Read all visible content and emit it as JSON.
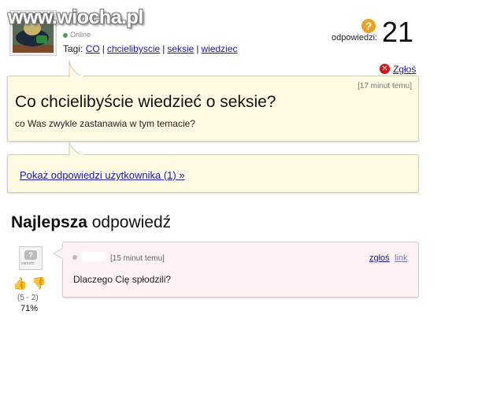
{
  "watermark": "www.wiocha.pl",
  "header": {
    "status_text": "Online",
    "tags_label": "Tagi:",
    "tags": [
      "CO",
      "chcielibyscie",
      "seksie",
      "wiedziec"
    ],
    "answers_label": "odpowiedzi:",
    "answers_count": "21",
    "report_label": "Zgłoś"
  },
  "question": {
    "time": "[17 minut temu]",
    "title": "Co chcielibyście wiedzieć o seksie?",
    "subtitle": "co Was zwykle zastanawia w tym temacie?"
  },
  "user_answers_link": "Pokaż odpowiedzi użytkownika (1) »",
  "best_answer": {
    "heading_bold": "Najlepsza",
    "heading_rest": " odpowiedź",
    "avatar_caption": "samotn",
    "votes": "(5 - 2)",
    "percent": "71%",
    "time": "[15 minut temu]",
    "report_label": "zgłoś",
    "link_label": "link",
    "text": "Dlaczego Cię spłodzili?"
  },
  "colors": {
    "bubble_yellow": "#fffbe3",
    "bubble_pink": "#fff2f2",
    "link_blue": "#1a1aa6"
  },
  "icons": [
    "question-icon",
    "report-x-icon",
    "thumb-up-icon",
    "thumb-down-icon",
    "status-dot-icon"
  ]
}
